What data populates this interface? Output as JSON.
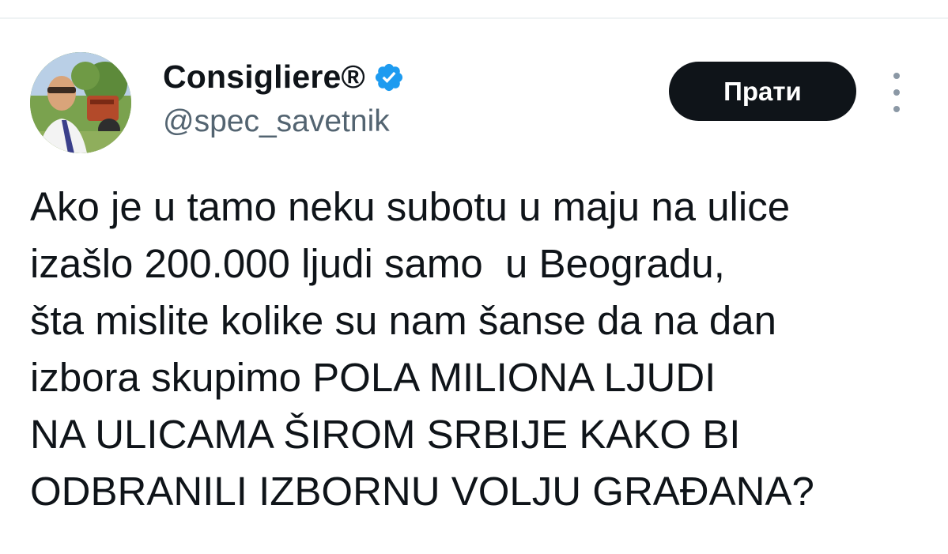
{
  "author": {
    "display_name": "Consigliere®",
    "handle": "@spec_savetnik",
    "verified": true,
    "avatar_icon": "profile-photo"
  },
  "actions": {
    "follow_label": "Прати",
    "more_icon": "more-vertical-icon"
  },
  "tweet": {
    "lines": [
      "Ako je u tamo neku subotu u maju na ulice",
      "izašlo 200.000 ljudi samo  u Beogradu,",
      "šta mislite kolike su nam šanse da na dan",
      "izbora skupimo POLA MILIONA LJUDI",
      "NA ULICAMA ŠIROM SRBIJE KAKO BI",
      "ODBRANILI IZBORNU VOLJU GRAĐANA?"
    ]
  },
  "colors": {
    "verified_badge": "#1d9bf0",
    "follow_button_bg": "#0f1419",
    "handle_text": "#536471"
  }
}
